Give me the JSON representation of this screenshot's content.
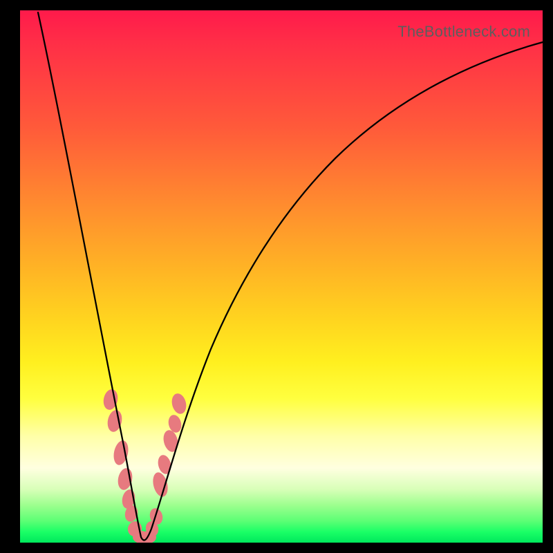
{
  "watermark": "TheBottleneck.com",
  "colors": {
    "blob": "#e77a7f",
    "curve": "#000000",
    "frame": "#000000"
  },
  "chart_data": {
    "type": "line",
    "title": "",
    "xlabel": "",
    "ylabel": "",
    "xlim": [
      0,
      100
    ],
    "ylim": [
      0,
      100
    ],
    "grid": false,
    "legend": false,
    "annotations": [
      "TheBottleneck.com"
    ],
    "note": "No axis ticks or numeric labels are visible; x and y are normalized 0–100 from the plot area. The curve is a V/cusp whose minimum reaches y≈0 near x≈23. Pink blobs mark points on both branches near the bottom.",
    "series": [
      {
        "name": "curve",
        "x": [
          3,
          4,
          5,
          6,
          7,
          8,
          9,
          10,
          11,
          12,
          13,
          14,
          15,
          16,
          17,
          18,
          19,
          20,
          21,
          22,
          22.7,
          23.3,
          24,
          25,
          26,
          27,
          28,
          29,
          30,
          32,
          34,
          36,
          38,
          40,
          44,
          48,
          52,
          56,
          60,
          64,
          68,
          72,
          76,
          80,
          84,
          88,
          92,
          96,
          100
        ],
        "y": [
          99,
          94,
          89,
          84,
          79,
          74,
          69,
          64,
          59,
          54,
          49,
          44,
          39,
          34,
          30,
          25,
          20,
          15,
          10,
          5,
          1,
          1,
          3,
          6,
          9,
          12,
          15,
          18,
          21,
          27,
          32,
          37,
          41,
          45,
          52,
          58,
          63,
          67,
          70.5,
          73.5,
          76,
          78.2,
          80,
          81.6,
          83,
          84.3,
          85.4,
          86.3,
          87.1
        ]
      }
    ],
    "markers": {
      "name": "pink-blobs",
      "color": "#e77a7f",
      "points": [
        {
          "x": 17.5,
          "y": 27
        },
        {
          "x": 18.3,
          "y": 23
        },
        {
          "x": 19.4,
          "y": 17
        },
        {
          "x": 20.2,
          "y": 12
        },
        {
          "x": 20.8,
          "y": 8
        },
        {
          "x": 21.4,
          "y": 5.5
        },
        {
          "x": 22.1,
          "y": 2.5
        },
        {
          "x": 23.1,
          "y": 1
        },
        {
          "x": 24.2,
          "y": 2.5
        },
        {
          "x": 25.2,
          "y": 5
        },
        {
          "x": 26.6,
          "y": 11
        },
        {
          "x": 27.4,
          "y": 14.5
        },
        {
          "x": 28.6,
          "y": 19
        },
        {
          "x": 29.3,
          "y": 22
        },
        {
          "x": 30.1,
          "y": 26
        }
      ]
    }
  }
}
